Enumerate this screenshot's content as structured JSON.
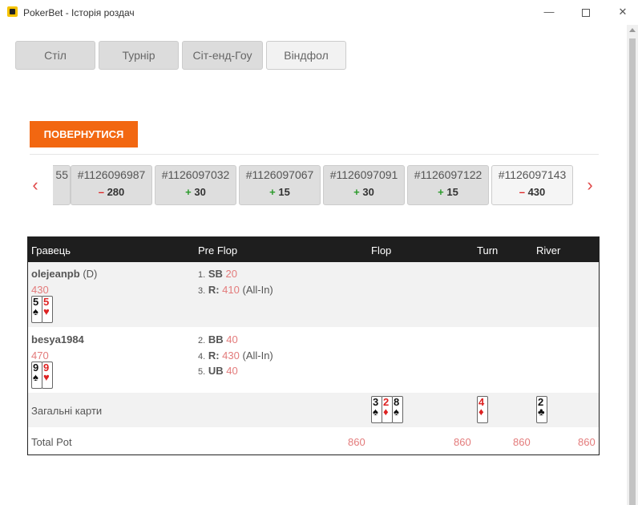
{
  "window": {
    "title": "PokerBet - Історія роздач"
  },
  "tabs": [
    {
      "label": "Стіл"
    },
    {
      "label": "Турнір"
    },
    {
      "label": "Сіт-енд-Гоу"
    },
    {
      "label": "Віндфол"
    }
  ],
  "back_button": "ПОВЕРНУТИСЯ",
  "hands": [
    {
      "id": "55",
      "sign": "",
      "amount": ""
    },
    {
      "id": "#1126096987",
      "sign": "–",
      "amount": "280",
      "result": "negative"
    },
    {
      "id": "#1126097032",
      "sign": "+",
      "amount": "30",
      "result": "positive"
    },
    {
      "id": "#1126097067",
      "sign": "+",
      "amount": "15",
      "result": "positive"
    },
    {
      "id": "#1126097091",
      "sign": "+",
      "amount": "30",
      "result": "positive"
    },
    {
      "id": "#1126097122",
      "sign": "+",
      "amount": "15",
      "result": "positive"
    },
    {
      "id": "#1126097143",
      "sign": "–",
      "amount": "430",
      "result": "negative",
      "selected": true
    }
  ],
  "table": {
    "headers": {
      "player": "Гравець",
      "preflop": "Pre Flop",
      "flop": "Flop",
      "turn": "Turn",
      "river": "River"
    },
    "players": [
      {
        "name": "olejeanpb",
        "dealer": "(D)",
        "stack": "430",
        "cards": [
          {
            "rank": "5",
            "suit": "♠"
          },
          {
            "rank": "5",
            "suit": "♥"
          }
        ],
        "actions": [
          {
            "num": "1.",
            "verb": "SB",
            "amount": "20",
            "extra": ""
          },
          {
            "num": "3.",
            "verb": "R:",
            "amount": "410",
            "extra": "(All-In)"
          }
        ]
      },
      {
        "name": "besya1984",
        "dealer": "",
        "stack": "470",
        "cards": [
          {
            "rank": "9",
            "suit": "♠"
          },
          {
            "rank": "9",
            "suit": "♥"
          }
        ],
        "actions": [
          {
            "num": "2.",
            "verb": "BB",
            "amount": "40",
            "extra": ""
          },
          {
            "num": "4.",
            "verb": "R:",
            "amount": "430",
            "extra": "(All-In)"
          },
          {
            "num": "5.",
            "verb": "UB",
            "amount": "40",
            "extra": ""
          }
        ]
      }
    ],
    "community_label": "Загальні карти",
    "flop_cards": [
      {
        "rank": "3",
        "suit": "♠"
      },
      {
        "rank": "2",
        "suit": "♦"
      },
      {
        "rank": "8",
        "suit": "♠"
      }
    ],
    "turn_card": {
      "rank": "4",
      "suit": "♦"
    },
    "river_card": {
      "rank": "2",
      "suit": "♣"
    },
    "total_pot_label": "Total Pot",
    "pot": {
      "preflop": "860",
      "flop": "860",
      "turn": "860",
      "river": "860"
    }
  },
  "colors": {
    "accent": "#f26711",
    "positive": "#2a9a2a",
    "negative": "#dd2222",
    "stack": "#e37b7b"
  }
}
